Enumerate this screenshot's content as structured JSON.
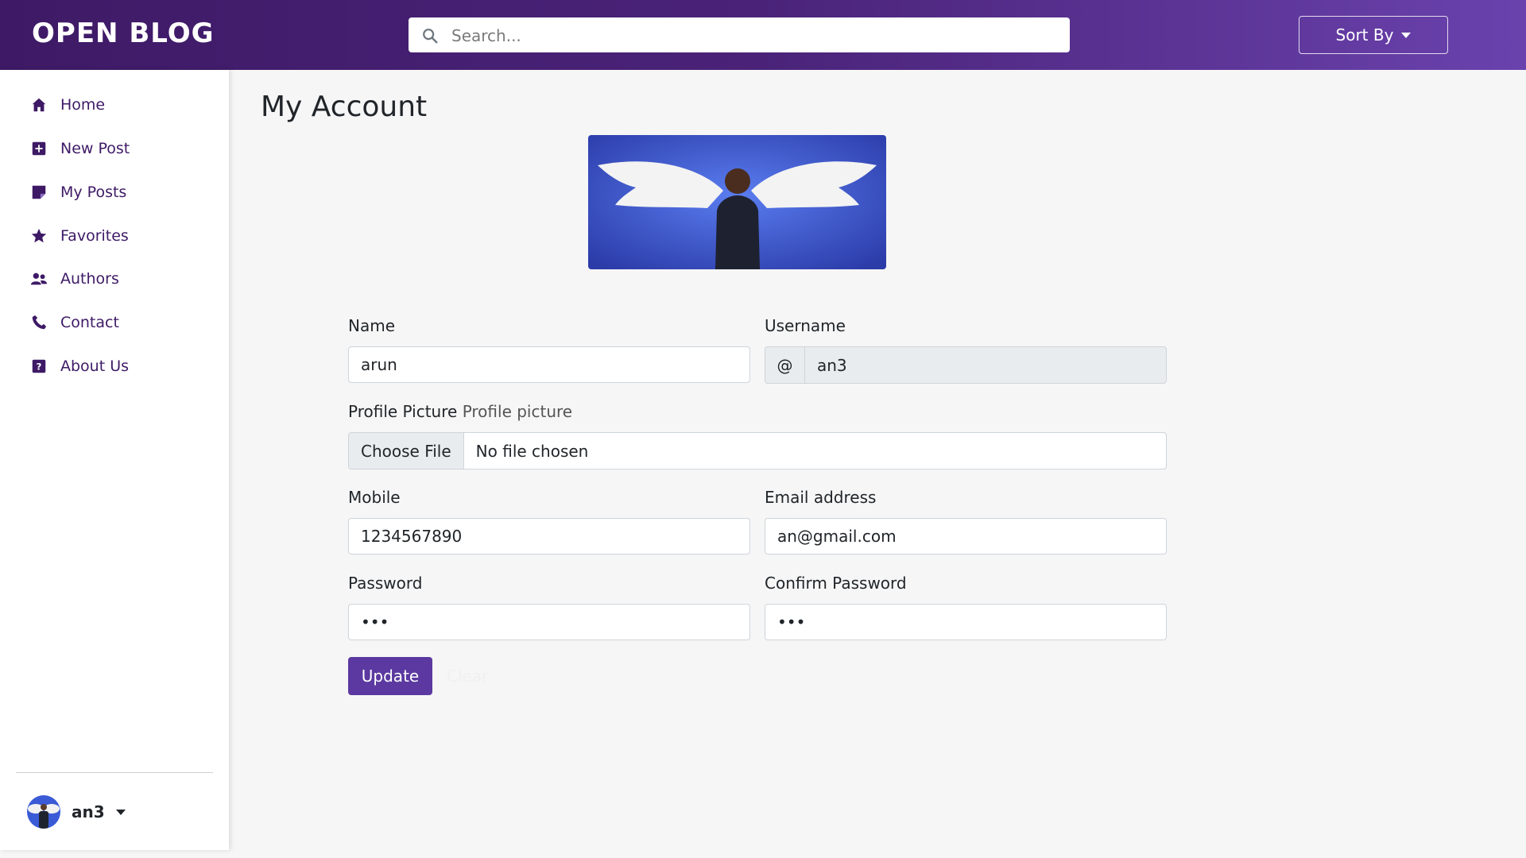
{
  "header": {
    "brand": "OPEN BLOG",
    "search_placeholder": "Search...",
    "sort_label": "Sort By",
    "colors": {
      "gradient_start": "#3e1a66",
      "gradient_end": "#6a42ad"
    }
  },
  "sidebar": {
    "items": [
      {
        "label": "Home",
        "icon": "home-icon"
      },
      {
        "label": "New Post",
        "icon": "plus-square-icon"
      },
      {
        "label": "My Posts",
        "icon": "note-icon"
      },
      {
        "label": "Favorites",
        "icon": "star-icon"
      },
      {
        "label": "Authors",
        "icon": "users-icon"
      },
      {
        "label": "Contact",
        "icon": "phone-icon"
      },
      {
        "label": "About Us",
        "icon": "question-square-icon"
      }
    ],
    "user": {
      "name": "an3"
    }
  },
  "main": {
    "title": "My Account",
    "form": {
      "name_label": "Name",
      "name_value": "arun",
      "username_label": "Username",
      "username_prefix": "@",
      "username_value": "an3",
      "profile_picture_label": "Profile Picture",
      "profile_picture_hint": "Profile picture",
      "file_button": "Choose File",
      "file_status": "No file chosen",
      "mobile_label": "Mobile",
      "mobile_value": "1234567890",
      "email_label": "Email address",
      "email_value": "an@gmail.com",
      "password_label": "Password",
      "password_value": "abc",
      "confirm_password_label": "Confirm Password",
      "confirm_password_value": "abc",
      "update_button": "Update",
      "clear_button": "Clear"
    }
  },
  "colors": {
    "accent": "#5b39a0",
    "nav_text": "#3e1a66",
    "background": "#f6f6f6"
  }
}
